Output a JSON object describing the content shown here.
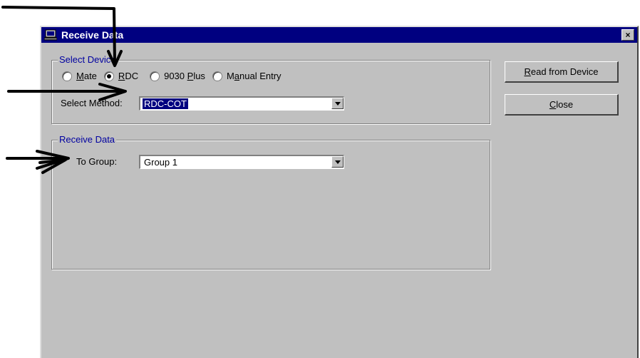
{
  "window": {
    "title": "Receive Data",
    "close_glyph": "×",
    "icon": "computer-icon"
  },
  "select_device": {
    "legend": "Select Device",
    "options": [
      {
        "label_prefix": "",
        "mnemonic": "M",
        "label_suffix": "ate",
        "checked": false
      },
      {
        "label_prefix": "",
        "mnemonic": "R",
        "label_suffix": "DC",
        "checked": true
      },
      {
        "label_prefix": "9030 ",
        "mnemonic": "P",
        "label_suffix": "lus",
        "checked": false
      },
      {
        "label_prefix": "M",
        "mnemonic": "a",
        "label_suffix": "nual Entry",
        "checked": false
      }
    ],
    "method_label": "Select Method:",
    "method_value": "RDC-COT"
  },
  "receive_data": {
    "legend": "Receive Data",
    "group_label": "To Group:",
    "group_value": "Group 1"
  },
  "buttons": {
    "read": {
      "mnemonic": "R",
      "rest": "ead from Device"
    },
    "close": {
      "mnemonic": "C",
      "rest": "lose"
    }
  }
}
